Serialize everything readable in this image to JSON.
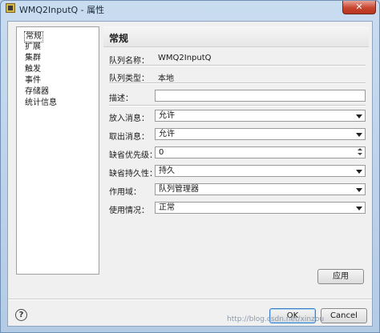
{
  "window": {
    "title": "WMQ2InputQ - 属性",
    "close_glyph": "✕"
  },
  "nav": {
    "items": [
      {
        "label": "常规",
        "selected": true
      },
      {
        "label": "扩展",
        "selected": false
      },
      {
        "label": "集群",
        "selected": false
      },
      {
        "label": "触发",
        "selected": false
      },
      {
        "label": "事件",
        "selected": false
      },
      {
        "label": "存储器",
        "selected": false
      },
      {
        "label": "统计信息",
        "selected": false
      }
    ]
  },
  "panel": {
    "title": "常规",
    "queue_name_label": "队列名称：",
    "queue_name_value": "WMQ2InputQ",
    "queue_type_label": "队列类型：",
    "queue_type_value": "本地",
    "description_label": "描述：",
    "description_value": "",
    "put_label": "放入消息：",
    "put_value": "允许",
    "get_label": "取出消息：",
    "get_value": "允许",
    "priority_label": "缺省优先级：",
    "priority_value": "0",
    "persistence_label": "缺省持久性：",
    "persistence_value": "持久",
    "scope_label": "作用域：",
    "scope_value": "队列管理器",
    "usage_label": "使用情况：",
    "usage_value": "正常",
    "apply_label": "应用"
  },
  "footer": {
    "help_glyph": "?",
    "ok_label": "OK",
    "cancel_label": "Cancel",
    "watermark": "http://blog.csdn.net/xinzou"
  },
  "colors": {
    "title_bar": "#c9dcf0",
    "close_button": "#c7452f",
    "ok_focus": "#3b80c4"
  }
}
